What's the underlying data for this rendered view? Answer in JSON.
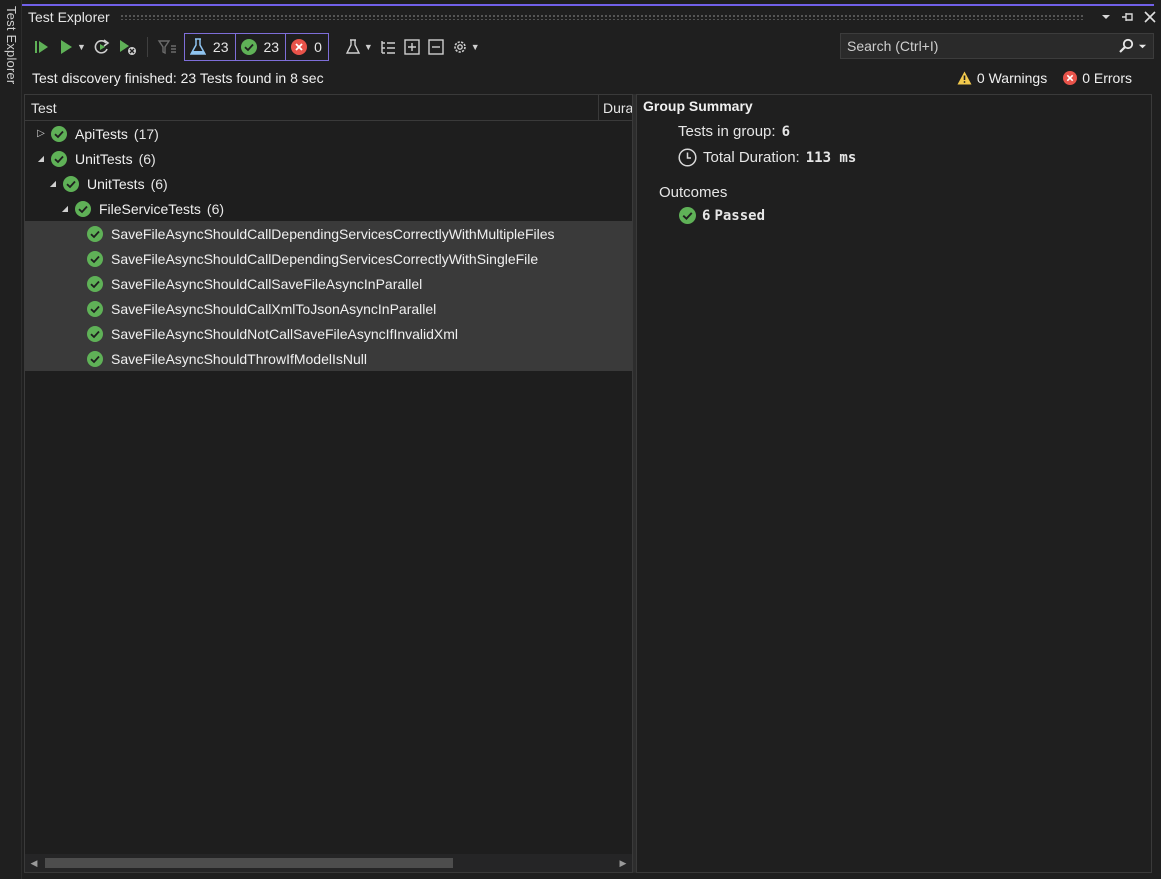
{
  "side_tab": {
    "label": "Test Explorer"
  },
  "window": {
    "title": "Test Explorer"
  },
  "titlebar": {
    "dropdown_icon": "chevron-down-icon",
    "pin_icon": "pin-icon",
    "close_icon": "close-icon"
  },
  "toolbar": {
    "filters": {
      "total": "23",
      "passed": "23",
      "failed": "0"
    },
    "search": {
      "placeholder": "Search (Ctrl+I)"
    }
  },
  "status": {
    "message": "Test discovery finished: 23 Tests found in 8 sec",
    "warnings": "0 Warnings",
    "errors": "0 Errors"
  },
  "columns": {
    "test": "Test",
    "duration": "Dura"
  },
  "tree": [
    {
      "label": "ApiTests",
      "count": "(17)",
      "expander": "collapsed",
      "selected": false
    },
    {
      "label": "UnitTests",
      "count": "(6)",
      "expander": "expanded",
      "selected": false
    },
    {
      "label": "UnitTests",
      "count": "(6)",
      "expander": "expanded",
      "selected": false
    },
    {
      "label": "FileServiceTests",
      "count": "(6)",
      "expander": "expanded",
      "selected": false
    },
    {
      "label": "SaveFileAsyncShouldCallDependingServicesCorrectlyWithMultipleFiles",
      "count": "",
      "expander": "none",
      "selected": true
    },
    {
      "label": "SaveFileAsyncShouldCallDependingServicesCorrectlyWithSingleFile",
      "count": "",
      "expander": "none",
      "selected": true
    },
    {
      "label": "SaveFileAsyncShouldCallSaveFileAsyncInParallel",
      "count": "",
      "expander": "none",
      "selected": true
    },
    {
      "label": "SaveFileAsyncShouldCallXmlToJsonAsyncInParallel",
      "count": "",
      "expander": "none",
      "selected": true
    },
    {
      "label": "SaveFileAsyncShouldNotCallSaveFileAsyncIfInvalidXml",
      "count": "",
      "expander": "none",
      "selected": true
    },
    {
      "label": "SaveFileAsyncShouldThrowIfModelIsNull",
      "count": "",
      "expander": "none",
      "selected": true
    }
  ],
  "summary": {
    "title": "Group Summary",
    "tests_in_group_label": "Tests in group:",
    "tests_in_group_value": "6",
    "total_duration_label": "Total Duration:",
    "total_duration_value": "113 ms",
    "outcomes_label": "Outcomes",
    "passed_count": "6",
    "passed_label": "Passed"
  },
  "colors": {
    "accent": "#7160e8",
    "pass_green": "#5fb157",
    "fail_red": "#e8534a",
    "warning_yellow": "#f2c94c"
  }
}
